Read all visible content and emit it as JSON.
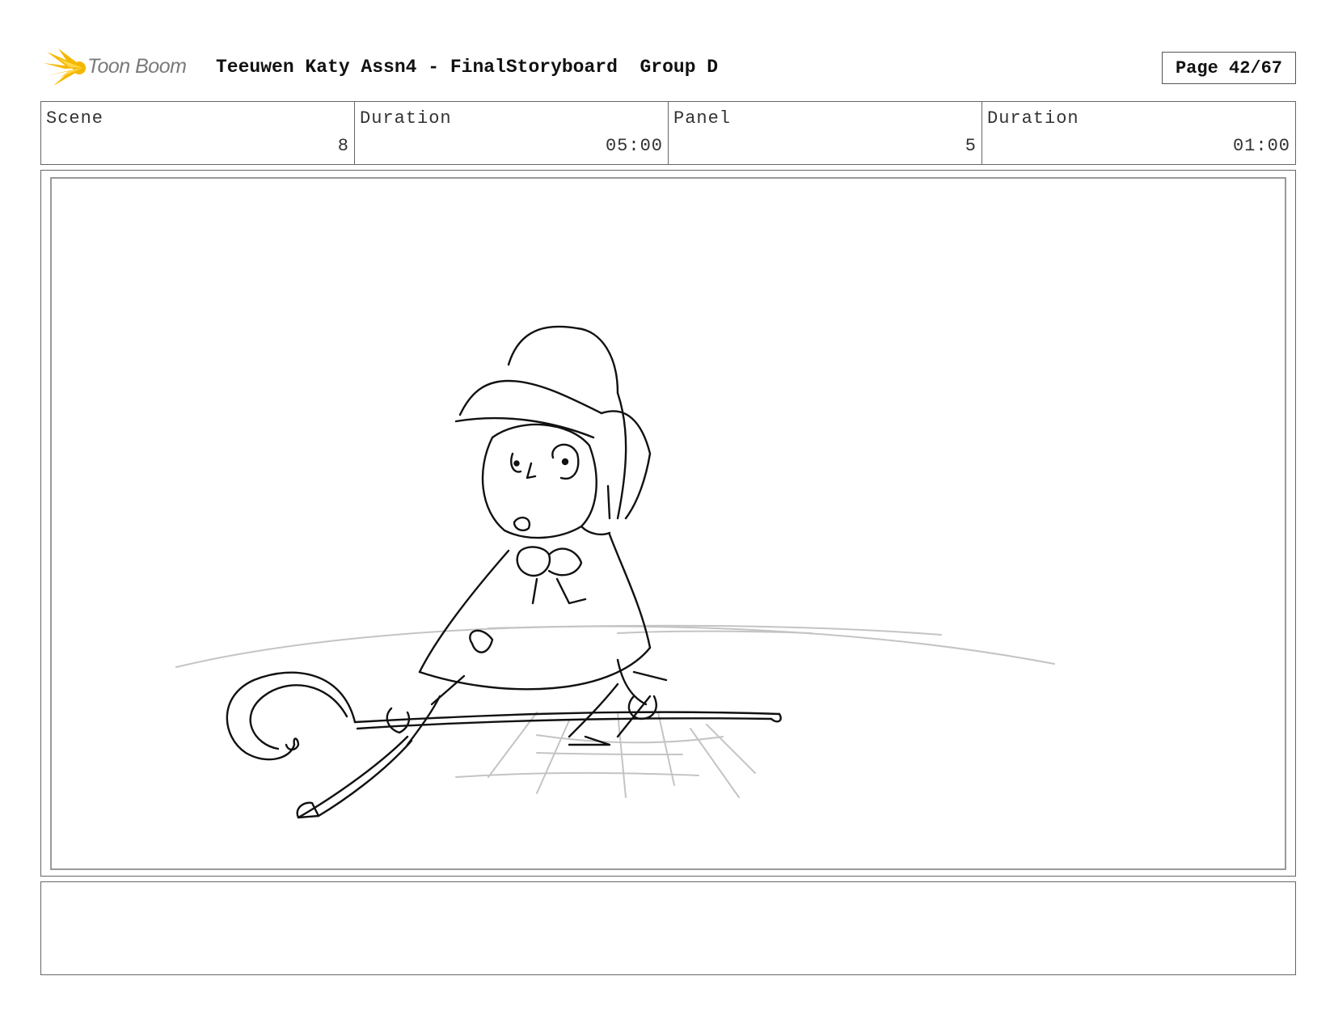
{
  "header": {
    "logo_text": "Toon Boom",
    "title": "Teeuwen Katy Assn4 - FinalStoryboard  Group D",
    "page": "Page 42/67"
  },
  "info": {
    "scene_label": "Scene",
    "scene_value": "8",
    "scene_duration_label": "Duration",
    "scene_duration_value": "05:00",
    "panel_label": "Panel",
    "panel_value": "5",
    "panel_duration_label": "Duration",
    "panel_duration_value": "01:00"
  },
  "notes": {
    "text": ""
  },
  "colors": {
    "logo_star": "#f5b800",
    "sketch_line": "#111111",
    "ground_line": "#bdbdbd"
  }
}
